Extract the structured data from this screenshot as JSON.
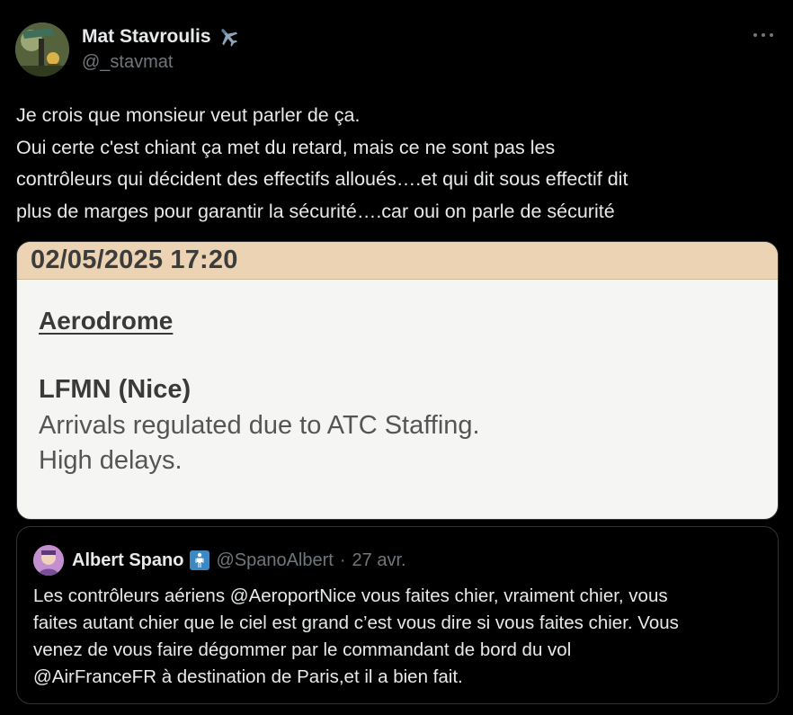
{
  "colors": {
    "background": "#000000",
    "text_primary": "#e7e9ea",
    "text_secondary": "#71767b",
    "border": "#2f3336",
    "media_header": "#ecd3b3",
    "media_body": "#f5f6f4"
  },
  "post": {
    "author": {
      "display_name": "Mat Stavroulis",
      "name_emoji_icon": "airplane-icon",
      "handle": "@_stavmat"
    },
    "more_icon": "more-horizontal-icon",
    "text_lines": [
      "Je crois que monsieur veut parler de ça.",
      "Oui certe c'est chiant ça met du retard, mais ce ne sont pas les",
      "contrôleurs qui décident des effectifs alloués….et qui dit sous effectif dit",
      "plus de marges pour garantir la sécurité….car oui on parle de sécurité"
    ],
    "media": {
      "date": "02/05/2025 17:20",
      "section": "Aerodrome",
      "airport": "LFMN (Nice)",
      "line1": "Arrivals regulated due to ATC Staffing.",
      "line2": "High delays."
    }
  },
  "quoted": {
    "display_name": "Albert Spano",
    "badge_icon": "person-standing-icon",
    "handle": "@SpanoAlbert",
    "separator": "·",
    "date": "27 avr.",
    "text_lines": [
      "Les contrôleurs aériens @AeroportNice vous faites chier, vraiment chier, vous",
      "faites autant chier que le ciel est grand c’est vous dire si vous faites chier. Vous",
      "venez de vous faire dégommer par le commandant de bord du vol",
      "@AirFranceFR à destination de Paris,et il a bien fait."
    ]
  }
}
